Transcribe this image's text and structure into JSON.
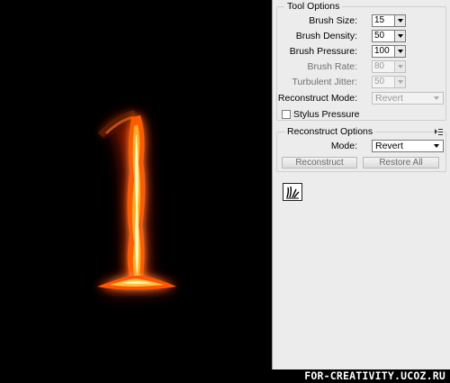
{
  "tool_options": {
    "title": "Tool Options",
    "brush_size": {
      "label": "Brush Size:",
      "value": "15"
    },
    "brush_density": {
      "label": "Brush Density:",
      "value": "50"
    },
    "brush_pressure": {
      "label": "Brush Pressure:",
      "value": "100"
    },
    "brush_rate": {
      "label": "Brush Rate:",
      "value": "80"
    },
    "turbulent_jitter": {
      "label": "Turbulent Jitter:",
      "value": "50"
    },
    "reconstruct_mode": {
      "label": "Reconstruct Mode:",
      "value": "Revert"
    },
    "stylus_pressure": {
      "label": "Stylus Pressure",
      "checked": false
    }
  },
  "reconstruct_options": {
    "title": "Reconstruct Options",
    "mode": {
      "label": "Mode:",
      "value": "Revert"
    },
    "reconstruct_button": "Reconstruct",
    "restore_all_button": "Restore All"
  },
  "watermark": "FOR-CREATIVITY.UCOZ.RU",
  "icons": [
    "flyout-menu-icon",
    "show-mesh-tool-icon"
  ],
  "colors": {
    "panel_bg": "#ececec",
    "canvas_bg": "#000000",
    "fire_core": "#fff3b0",
    "fire_outer": "#ff6a00"
  }
}
